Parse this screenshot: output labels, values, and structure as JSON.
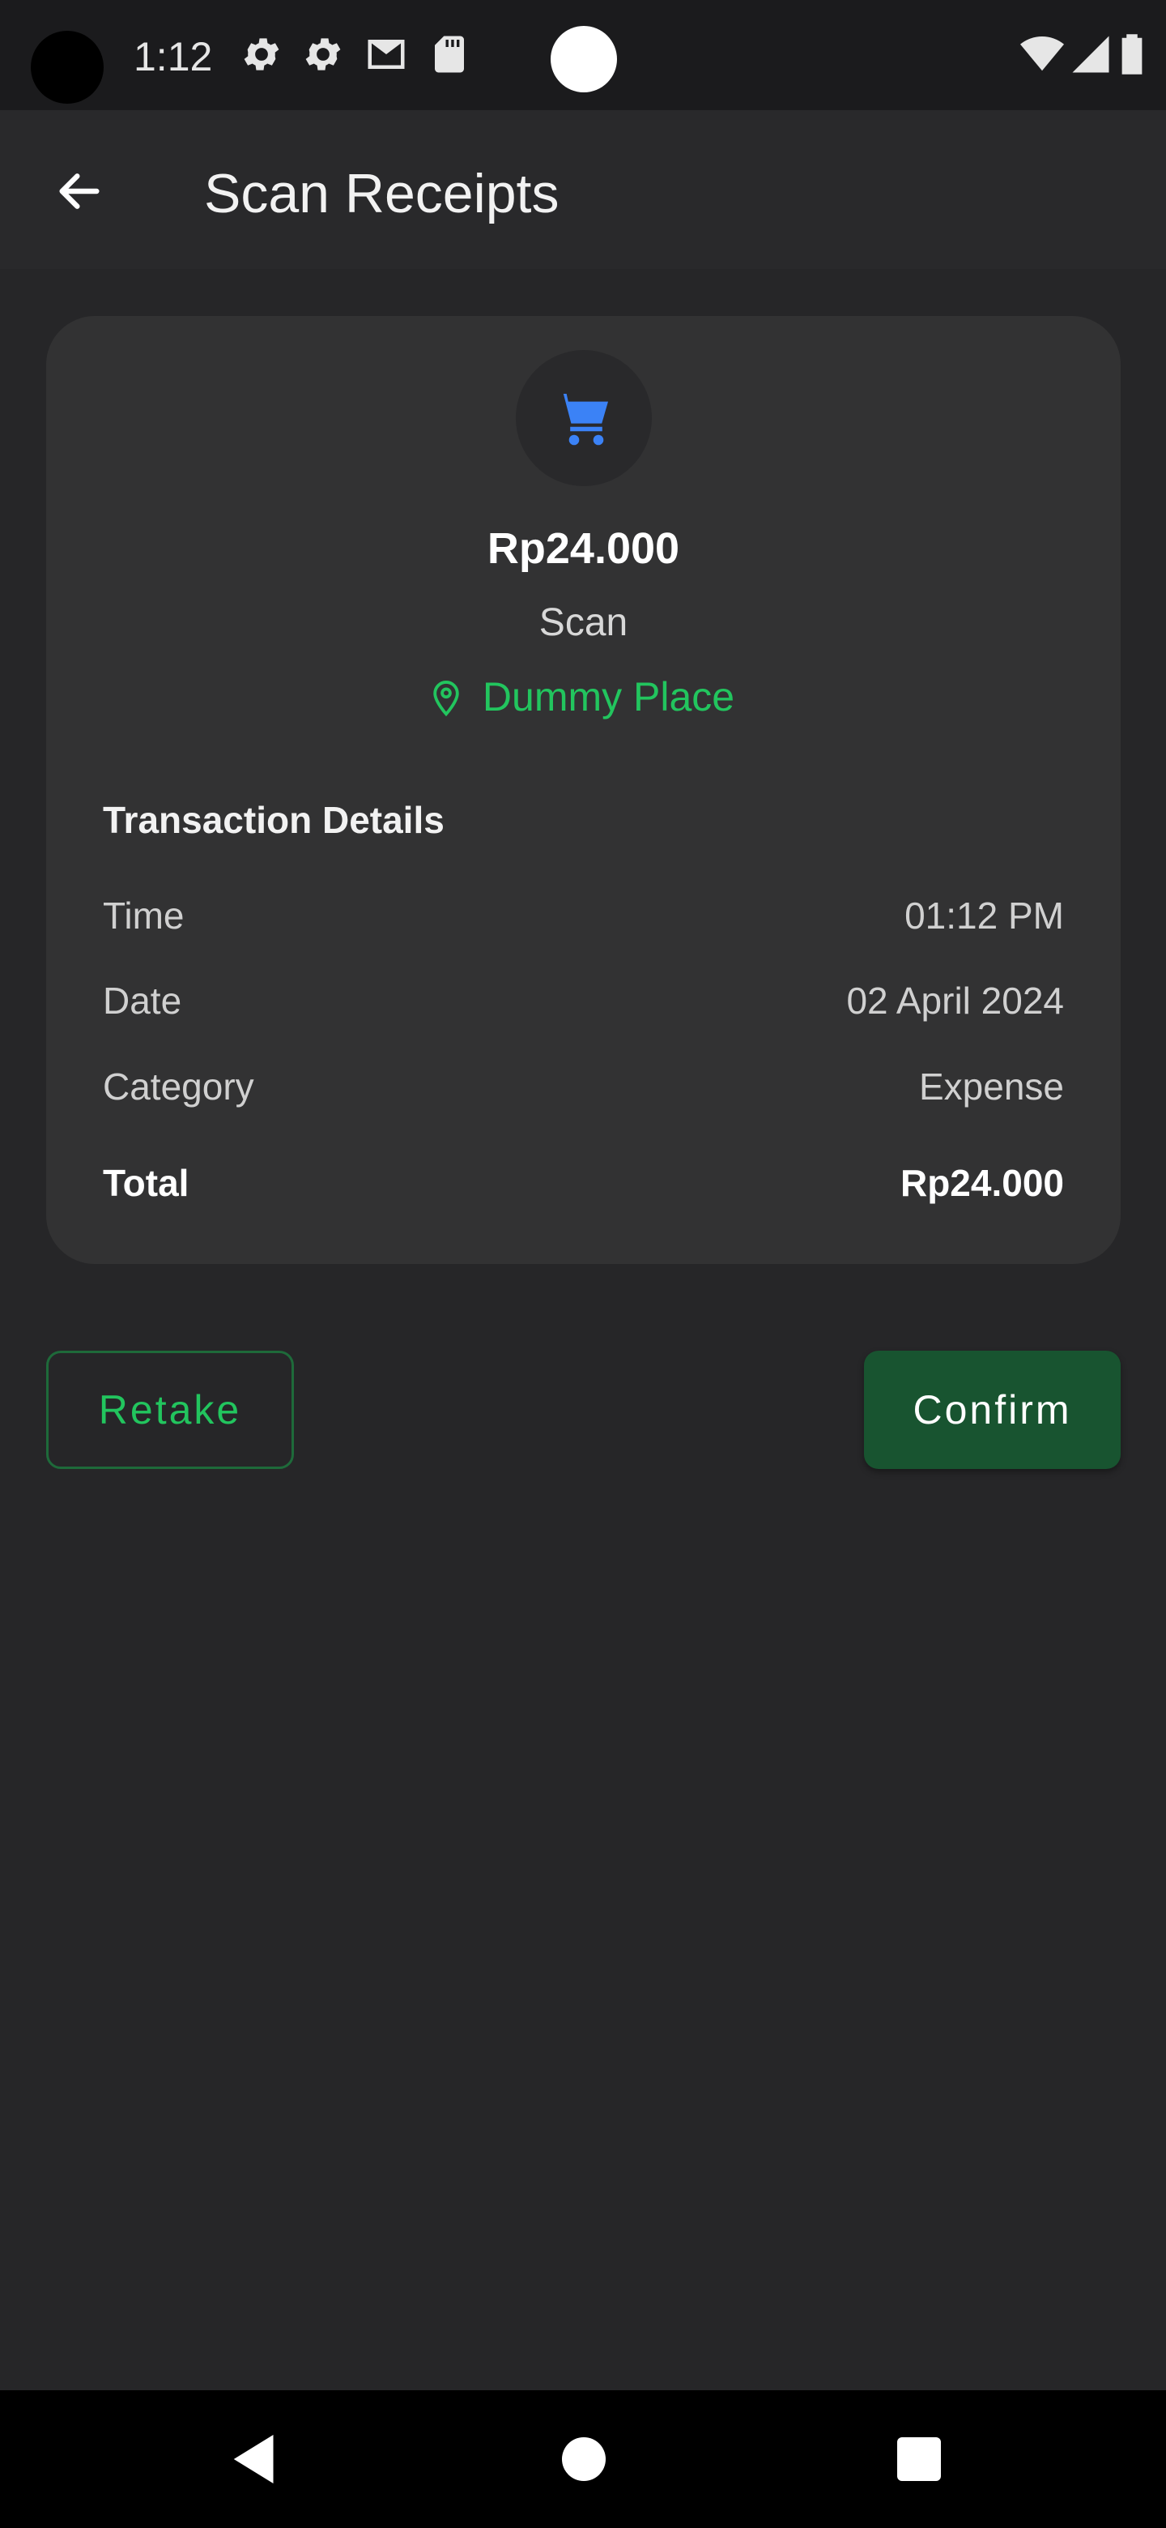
{
  "status_bar": {
    "time": "1:12",
    "icons": [
      "gear-icon",
      "gear-icon",
      "mail-icon",
      "sd-card-icon",
      "wifi-icon",
      "signal-icon",
      "battery-icon"
    ]
  },
  "app_bar": {
    "title": "Scan Receipts",
    "back_icon": "arrow-left-icon"
  },
  "receipt": {
    "icon": "shopping-cart-icon",
    "icon_color": "#3b82f6",
    "amount": "Rp24.000",
    "source": "Scan",
    "location": "Dummy Place",
    "location_color": "#22c55e",
    "details_title": "Transaction Details",
    "rows": [
      {
        "label": "Time",
        "value": "01:12 PM"
      },
      {
        "label": "Date",
        "value": "02 April 2024"
      },
      {
        "label": "Category",
        "value": "Expense"
      }
    ],
    "total": {
      "label": "Total",
      "value": "Rp24.000"
    }
  },
  "actions": {
    "retake_label": "Retake",
    "confirm_label": "Confirm",
    "accent_color": "#22c55e",
    "confirm_bg": "#185430"
  },
  "nav_bar": {
    "icons": [
      "nav-back-icon",
      "nav-home-icon",
      "nav-recents-icon"
    ]
  }
}
